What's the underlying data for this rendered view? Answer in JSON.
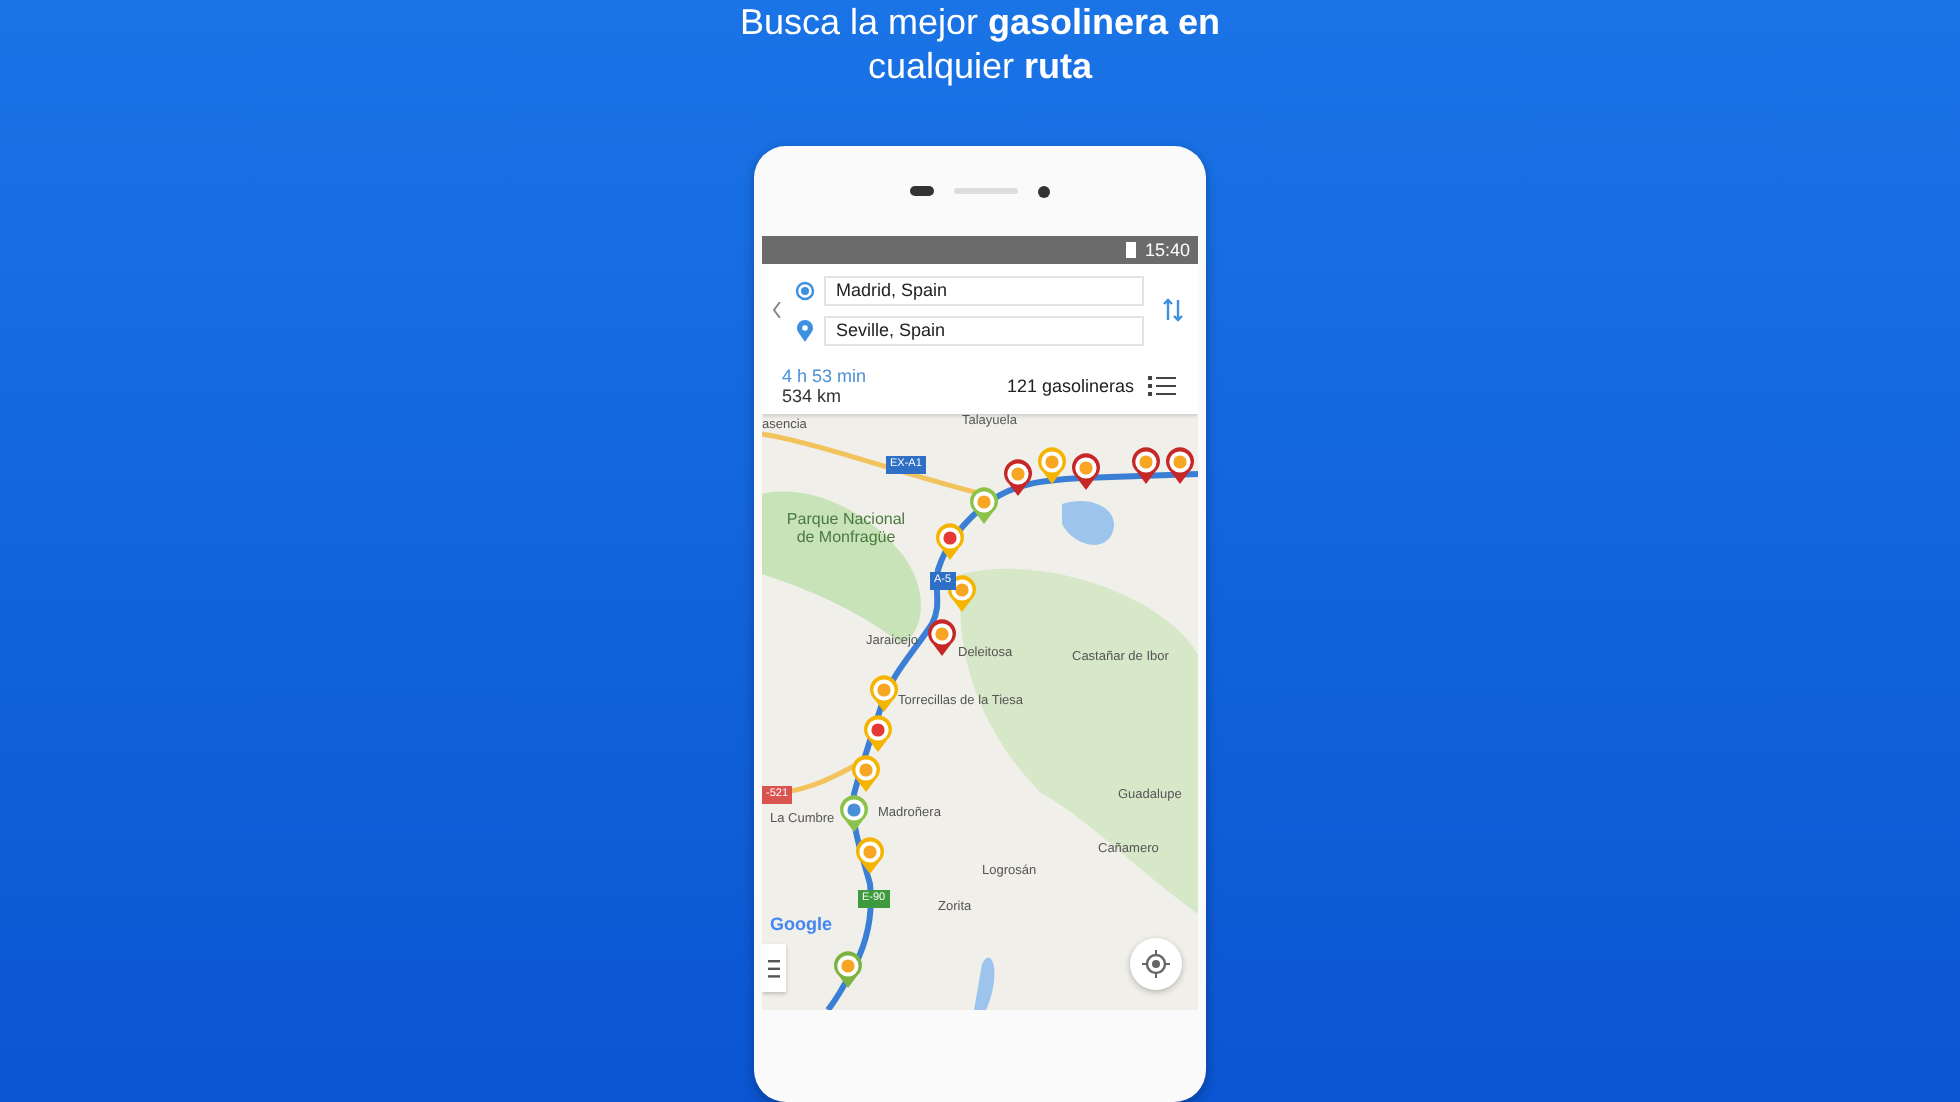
{
  "headline": "Busca la mejor **gasolinera en** cualquier **ruta**",
  "status_bar": {
    "time": "15:40"
  },
  "route": {
    "origin": "Madrid, Spain",
    "destination": "Seville, Spain"
  },
  "summary": {
    "duration": "4 h 53 min",
    "distance": "534 km",
    "stations": "121 gasolineras"
  },
  "map": {
    "labels": [
      {
        "text": "asencia",
        "kind": "town"
      },
      {
        "text": "Talayuela",
        "kind": "town"
      },
      {
        "text": "Parque Nacional de Monfragüe",
        "kind": "park"
      },
      {
        "text": "Jaraicejo",
        "kind": "town"
      },
      {
        "text": "Deleitosa",
        "kind": "town"
      },
      {
        "text": "Castañar de Ibor",
        "kind": "town"
      },
      {
        "text": "Torrecillas de la Tiesa",
        "kind": "town"
      },
      {
        "text": "La Cumbre",
        "kind": "town"
      },
      {
        "text": "Madroñera",
        "kind": "town"
      },
      {
        "text": "Guadalupe",
        "kind": "town"
      },
      {
        "text": "Cañamero",
        "kind": "town"
      },
      {
        "text": "Logrosán",
        "kind": "town"
      },
      {
        "text": "Zorita",
        "kind": "town"
      }
    ],
    "shields": [
      {
        "text": "EX-A1",
        "color": "#2f6fc6"
      },
      {
        "text": "A-5",
        "color": "#2f6fc6"
      },
      {
        "text": "-521",
        "color": "#d9534f"
      },
      {
        "text": "E-90",
        "color": "#3d9a3d"
      }
    ],
    "logo": "Google"
  }
}
